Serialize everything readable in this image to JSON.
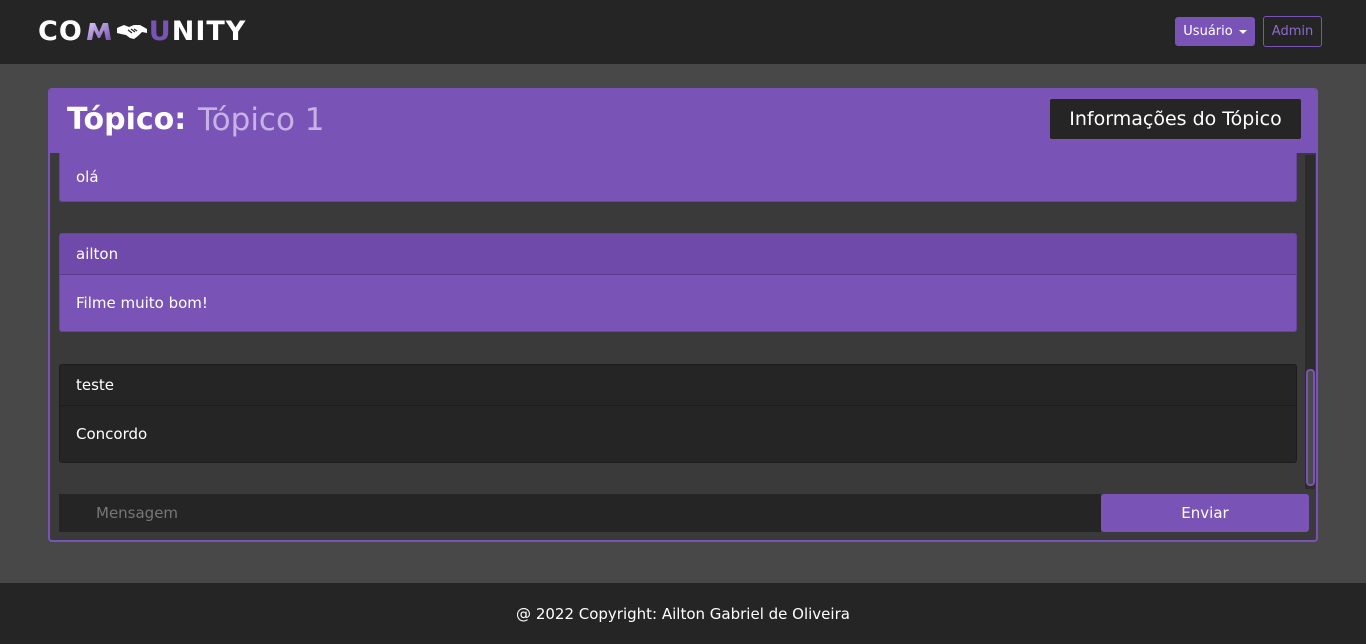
{
  "navbar": {
    "logo_left": "CO",
    "logo_right": "NITY",
    "logo_u": "U",
    "user_menu_label": "Usuário",
    "admin_label": "Admin"
  },
  "topic": {
    "label": "Tópico:",
    "name": "Tópico 1",
    "info_button": "Informações do Tópico"
  },
  "messages": [
    {
      "author": "",
      "text": "olá",
      "style": "purple"
    },
    {
      "author": "ailton",
      "text": "Filme muito bom!",
      "style": "purple"
    },
    {
      "author": "teste",
      "text": "Concordo",
      "style": "dark"
    }
  ],
  "composer": {
    "placeholder": "Mensagem",
    "value": "",
    "send_label": "Enviar"
  },
  "footer": {
    "copyright": "@ 2022 Copyright: Ailton Gabriel de Oliveira"
  },
  "colors": {
    "accent": "#7a53b6",
    "navbar_bg": "#252525",
    "page_bg": "#484848"
  }
}
